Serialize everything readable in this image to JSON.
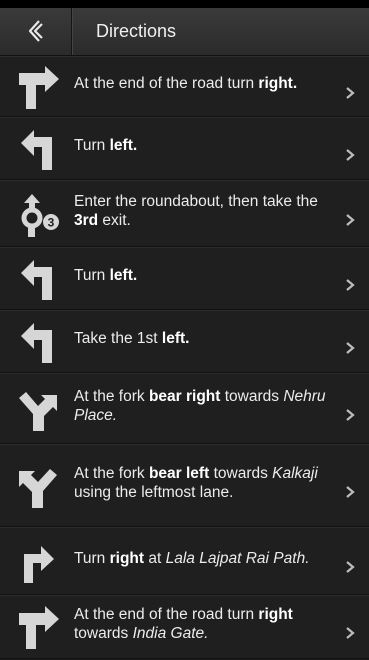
{
  "header": {
    "title": "Directions",
    "back_icon": "back-chevron-icon"
  },
  "steps": [
    {
      "icon": "arrow-turn-right-icon",
      "parts": [
        {
          "t": "At the end of the road turn "
        },
        {
          "t": "right.",
          "b": true
        }
      ]
    },
    {
      "icon": "arrow-turn-left-icon",
      "parts": [
        {
          "t": "Turn "
        },
        {
          "t": "left.",
          "b": true
        }
      ]
    },
    {
      "icon": "roundabout-exit-3-icon",
      "badge": "3",
      "parts": [
        {
          "t": "Enter the roundabout, then take the "
        },
        {
          "t": "3rd",
          "b": true
        },
        {
          "t": " exit."
        }
      ]
    },
    {
      "icon": "arrow-turn-left-icon",
      "parts": [
        {
          "t": "Turn "
        },
        {
          "t": "left.",
          "b": true
        }
      ]
    },
    {
      "icon": "arrow-turn-left-icon",
      "parts": [
        {
          "t": "Take the 1st "
        },
        {
          "t": "left.",
          "b": true
        }
      ]
    },
    {
      "icon": "fork-bear-right-icon",
      "parts": [
        {
          "t": "At the fork "
        },
        {
          "t": "bear right",
          "b": true
        },
        {
          "t": " towards "
        },
        {
          "t": "Nehru Place.",
          "i": true
        }
      ]
    },
    {
      "icon": "fork-bear-left-icon",
      "parts": [
        {
          "t": "At the fork "
        },
        {
          "t": "bear left",
          "b": true
        },
        {
          "t": " towards "
        },
        {
          "t": "Kalkaji",
          "i": true
        },
        {
          "t": " using the leftmost lane."
        }
      ]
    },
    {
      "icon": "arrow-slight-right-icon",
      "parts": [
        {
          "t": "Turn "
        },
        {
          "t": "right",
          "b": true
        },
        {
          "t": " at "
        },
        {
          "t": "Lala Lajpat Rai Path.",
          "i": true
        }
      ]
    },
    {
      "icon": "arrow-turn-right-icon",
      "parts": [
        {
          "t": "At the end of the road turn "
        },
        {
          "t": "right",
          "b": true
        },
        {
          "t": " towards "
        },
        {
          "t": "India Gate.",
          "i": true
        }
      ]
    }
  ],
  "colors": {
    "background": "#1c1c1c",
    "header": "#333333",
    "text": "#ececec",
    "icon": "#d6d6d6",
    "chevron": "#bdbdbd"
  }
}
